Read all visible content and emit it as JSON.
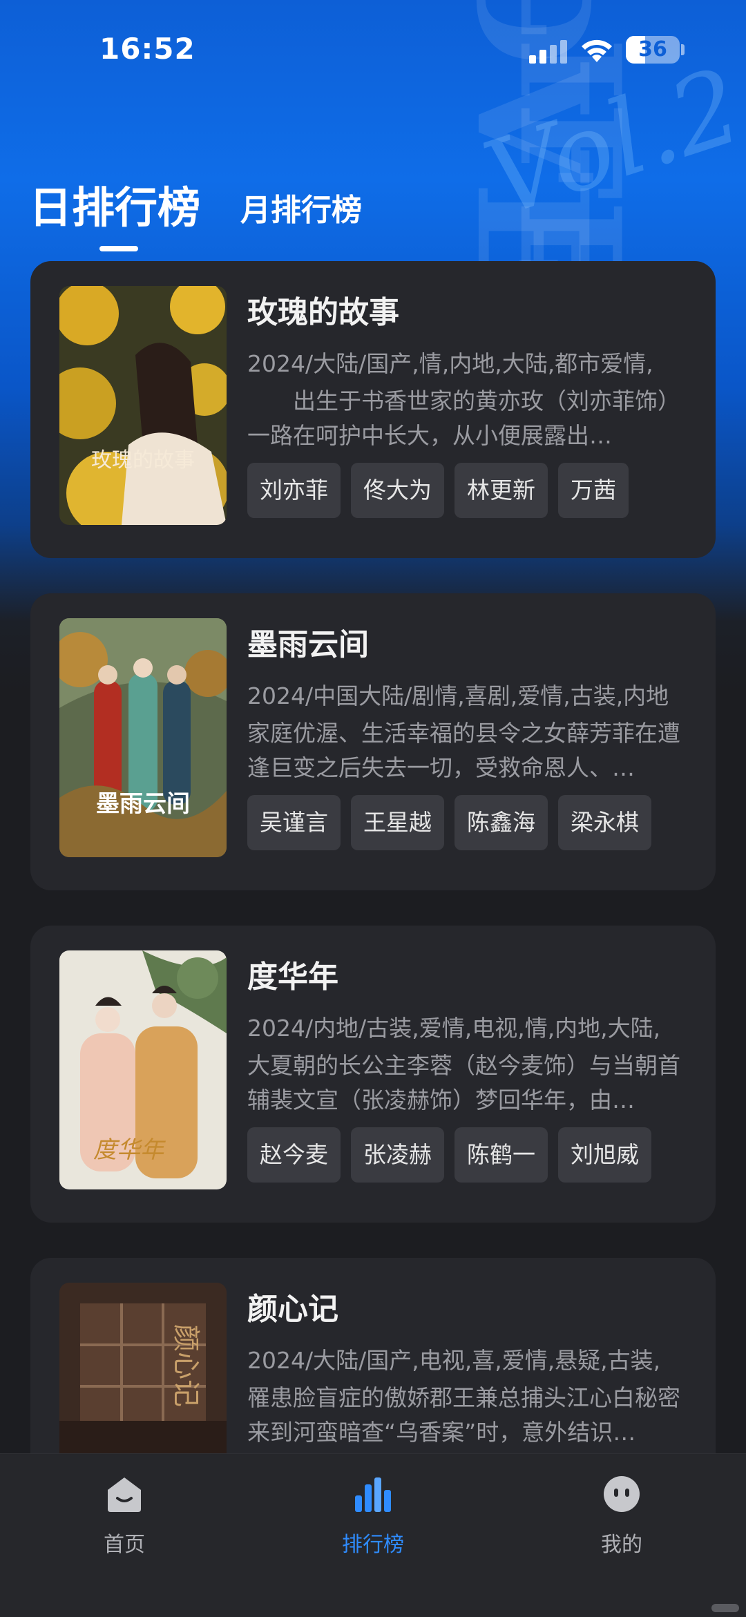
{
  "status_bar": {
    "time": "16:52",
    "battery": "36",
    "battery_level": 0.36
  },
  "tabs": [
    {
      "label": "日排行榜",
      "active": true
    },
    {
      "label": "月排行榜",
      "active": false
    }
  ],
  "dramas": [
    {
      "title": "玫瑰的故事",
      "meta": "2024/大陆/国产,情,内地,大陆,都市爱情,",
      "description": "　　出生于书香世家的黄亦玫（刘亦菲饰）一路在呵护中长大，从小便展露出…",
      "poster_text": "玫瑰的故事",
      "tags": [
        "刘亦菲",
        "佟大为",
        "林更新",
        "万茜"
      ]
    },
    {
      "title": "墨雨云间",
      "meta": "2024/中国大陆/剧情,喜剧,爱情,古装,内地",
      "description": "家庭优渥、生活幸福的县令之女薛芳菲在遭逢巨变之后失去一切，受救命恩人、…",
      "poster_text": "墨雨云间",
      "tags": [
        "吴谨言",
        "王星越",
        "陈鑫海",
        "梁永棋"
      ]
    },
    {
      "title": "度华年",
      "meta": "2024/内地/古装,爱情,电视,情,内地,大陆,",
      "description": "大夏朝的长公主李蓉（赵今麦饰）与当朝首辅裴文宣（张凌赫饰）梦回华年，由…",
      "poster_text": "度华年",
      "tags": [
        "赵今麦",
        "张凌赫",
        "陈鹤一",
        "刘旭威"
      ]
    },
    {
      "title": "颜心记",
      "meta": "2024/大陆/国产,电视,喜,爱情,悬疑,古装,",
      "description": "罹患脸盲症的傲娇郡王兼总捕头江心白秘密来到河蛮暗查“乌香案”时，意外结识…",
      "poster_text": "颜心记",
      "tags": []
    }
  ],
  "bottom_nav": [
    {
      "label": "首页",
      "icon": "home-icon",
      "active": false
    },
    {
      "label": "排行榜",
      "icon": "bar-chart-icon",
      "active": true
    },
    {
      "label": "我的",
      "icon": "profile-face-icon",
      "active": false
    }
  ],
  "colors": {
    "accent": "#2f8cff",
    "card": "#26272c",
    "tag": "#3a3b41",
    "background": "#1c1d21"
  }
}
